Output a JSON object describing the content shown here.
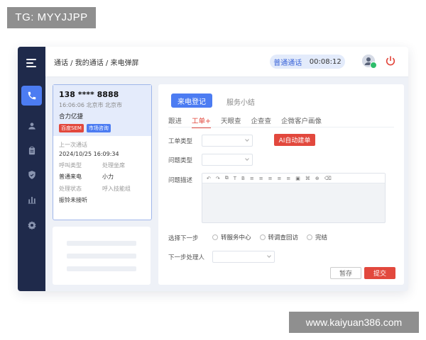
{
  "watermarks": {
    "top": "TG: MYYJJPP",
    "bottom": "www.kaiyuan386.com"
  },
  "sidebar": {
    "items": [
      {
        "icon": "phone-icon",
        "active": true
      },
      {
        "icon": "user-icon",
        "active": false
      },
      {
        "icon": "clipboard-icon",
        "active": false
      },
      {
        "icon": "shield-icon",
        "active": false
      },
      {
        "icon": "bar-chart-icon",
        "active": false
      },
      {
        "icon": "gear-icon",
        "active": false
      }
    ]
  },
  "header": {
    "breadcrumb": "通话 / 我的通话 / 来电弹屏",
    "call_status": "普通通话",
    "call_timer": "00:08:12"
  },
  "caller_card": {
    "phone": "138 **** 8888",
    "time_location": "16:06:06  北京市 北京市",
    "company": "合力亿捷",
    "tags": [
      "百度SEM",
      "市场咨询"
    ],
    "last_call_label": "上一次通话",
    "last_call_value": "2024/10/25  16:09:34",
    "fields": [
      {
        "label": "呼叫类型",
        "value": "普通来电"
      },
      {
        "label": "处理坐席",
        "value": "小力"
      },
      {
        "label": "处理状态",
        "value": "振铃未接听"
      },
      {
        "label": "呼入技能组",
        "value": ""
      }
    ]
  },
  "main": {
    "tabs": [
      "来电登记",
      "服务小结"
    ],
    "subtabs": [
      "跟进",
      "工单+",
      "天眼查",
      "企查查",
      "企微客户画像"
    ],
    "form": {
      "ticket_type_label": "工单类型",
      "issue_type_label": "问题类型",
      "description_label": "问题描述",
      "ai_button": "AI自动建单",
      "toolbar": [
        "↶",
        "↷",
        "⧉",
        "T",
        "B",
        "≡",
        "≡",
        "≡",
        "≡",
        "≡",
        "▣",
        "⌘",
        "⊕",
        "⌫"
      ],
      "next_step_label": "选择下一步",
      "next_step_options": [
        "转服务中心",
        "转调查回访",
        "完结"
      ],
      "next_handler_label": "下一步处理人",
      "save_button": "暂存",
      "submit_button": "提交"
    }
  },
  "colors": {
    "primary": "#4c7cf2",
    "danger": "#e2483d",
    "sidebar": "#1f2a4b"
  }
}
